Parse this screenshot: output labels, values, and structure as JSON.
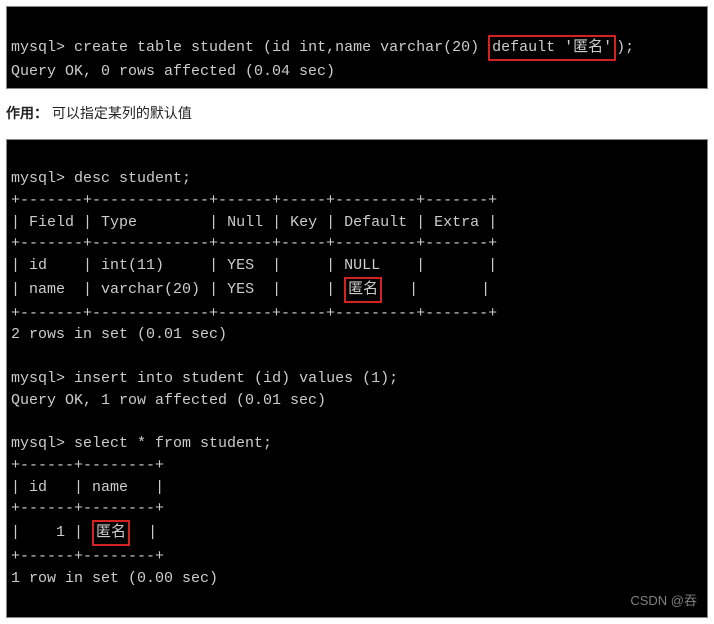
{
  "terminal1": {
    "prompt": "mysql>",
    "cmd_before": "create table student (id int,name varchar(20) ",
    "cmd_highlight": "default '匿名'",
    "cmd_after": ");",
    "result": "Query OK, 0 rows affected (0.04 sec)"
  },
  "caption": {
    "label": "作用：",
    "text": "可以指定某列的默认值"
  },
  "terminal2": {
    "prompt1": "mysql>",
    "cmd1": "desc student;",
    "border_top": "+-------+-------------+------+-----+---------+-------+",
    "hdr_field": "Field",
    "hdr_type": "Type",
    "hdr_null": "Null",
    "hdr_key": "Key",
    "hdr_default": "Default",
    "hdr_extra": "Extra",
    "border_mid": "+-------+-------------+------+-----+---------+-------+",
    "row1_field": "id",
    "row1_type": "int(11)",
    "row1_null": "YES",
    "row1_key": "",
    "row1_default": "NULL",
    "row1_extra": "",
    "row2_field": "name",
    "row2_type": "varchar(20)",
    "row2_null": "YES",
    "row2_key": "",
    "row2_default_hl": "匿名",
    "row2_extra": "",
    "border_bot": "+-------+-------------+------+-----+---------+-------+",
    "result1": "2 rows in set (0.01 sec)",
    "prompt2": "mysql>",
    "cmd2": "insert into student (id) values (1);",
    "result2": "Query OK, 1 row affected (0.01 sec)",
    "prompt3": "mysql>",
    "cmd3": "select * from student;",
    "sel_border_top": "+------+--------+",
    "sel_hdr_id": "id",
    "sel_hdr_name": "name",
    "sel_border_mid": "+------+--------+",
    "sel_row_id": "1",
    "sel_row_name_hl": "匿名",
    "sel_border_bot": "+------+--------+",
    "result3": "1 row in set (0.00 sec)",
    "watermark": "CSDN @吞"
  },
  "chart_data": {
    "type": "table",
    "desc_student": {
      "columns": [
        "Field",
        "Type",
        "Null",
        "Key",
        "Default",
        "Extra"
      ],
      "rows": [
        [
          "id",
          "int(11)",
          "YES",
          "",
          "NULL",
          ""
        ],
        [
          "name",
          "varchar(20)",
          "YES",
          "",
          "匿名",
          ""
        ]
      ]
    },
    "select_student": {
      "columns": [
        "id",
        "name"
      ],
      "rows": [
        [
          1,
          "匿名"
        ]
      ]
    }
  }
}
